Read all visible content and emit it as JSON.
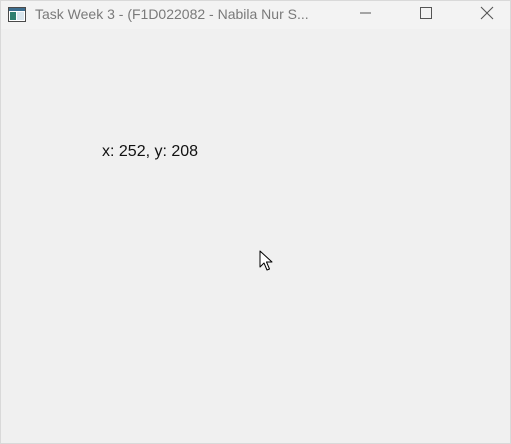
{
  "window": {
    "title": "Task Week 3 - (F1D022082 - Nabila Nur S...",
    "icon": "app-window-icon",
    "controls": {
      "minimize": "minimize-icon",
      "maximize": "maximize-icon",
      "close": "close-icon"
    }
  },
  "main": {
    "coordinates_text": "x: 252, y: 208"
  },
  "cursor": {
    "icon": "mouse-pointer-icon"
  },
  "colors": {
    "background": "#f0f0f0",
    "titlebar": "#f3f3f3",
    "title_text": "#7a7a7a",
    "label_text": "#111111"
  }
}
